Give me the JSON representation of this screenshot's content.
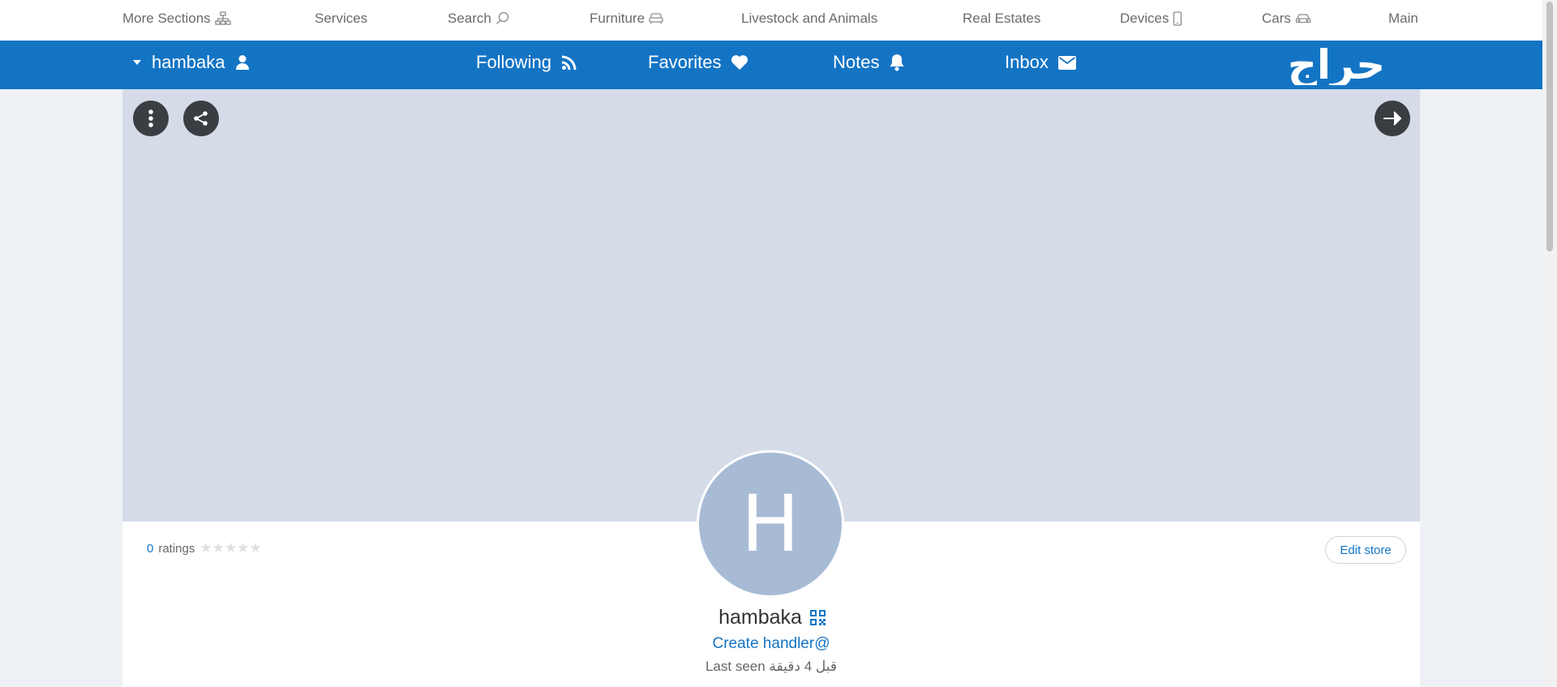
{
  "top_nav": {
    "more_sections": "More Sections",
    "services": "Services",
    "search": "Search",
    "furniture": "Furniture",
    "livestock": "Livestock and Animals",
    "real_estates": "Real Estates",
    "devices": "Devices",
    "cars": "Cars",
    "main": "Main"
  },
  "user_bar": {
    "username": "hambaka",
    "following": "Following",
    "favorites": "Favorites",
    "notes": "Notes",
    "inbox": "Inbox",
    "logo_text": "حراج"
  },
  "profile": {
    "avatar_letter": "H",
    "rating_count": "0",
    "ratings_label": "ratings",
    "stars": "★★★★★",
    "edit_store": "Edit store",
    "name": "hambaka",
    "create_handler": "Create handler@",
    "last_seen": "Last seen قبل 4 دقيقة"
  },
  "colors": {
    "brand_blue": "#1474c4",
    "cover": "#d5dce8",
    "avatar": "#a7bbd5"
  }
}
